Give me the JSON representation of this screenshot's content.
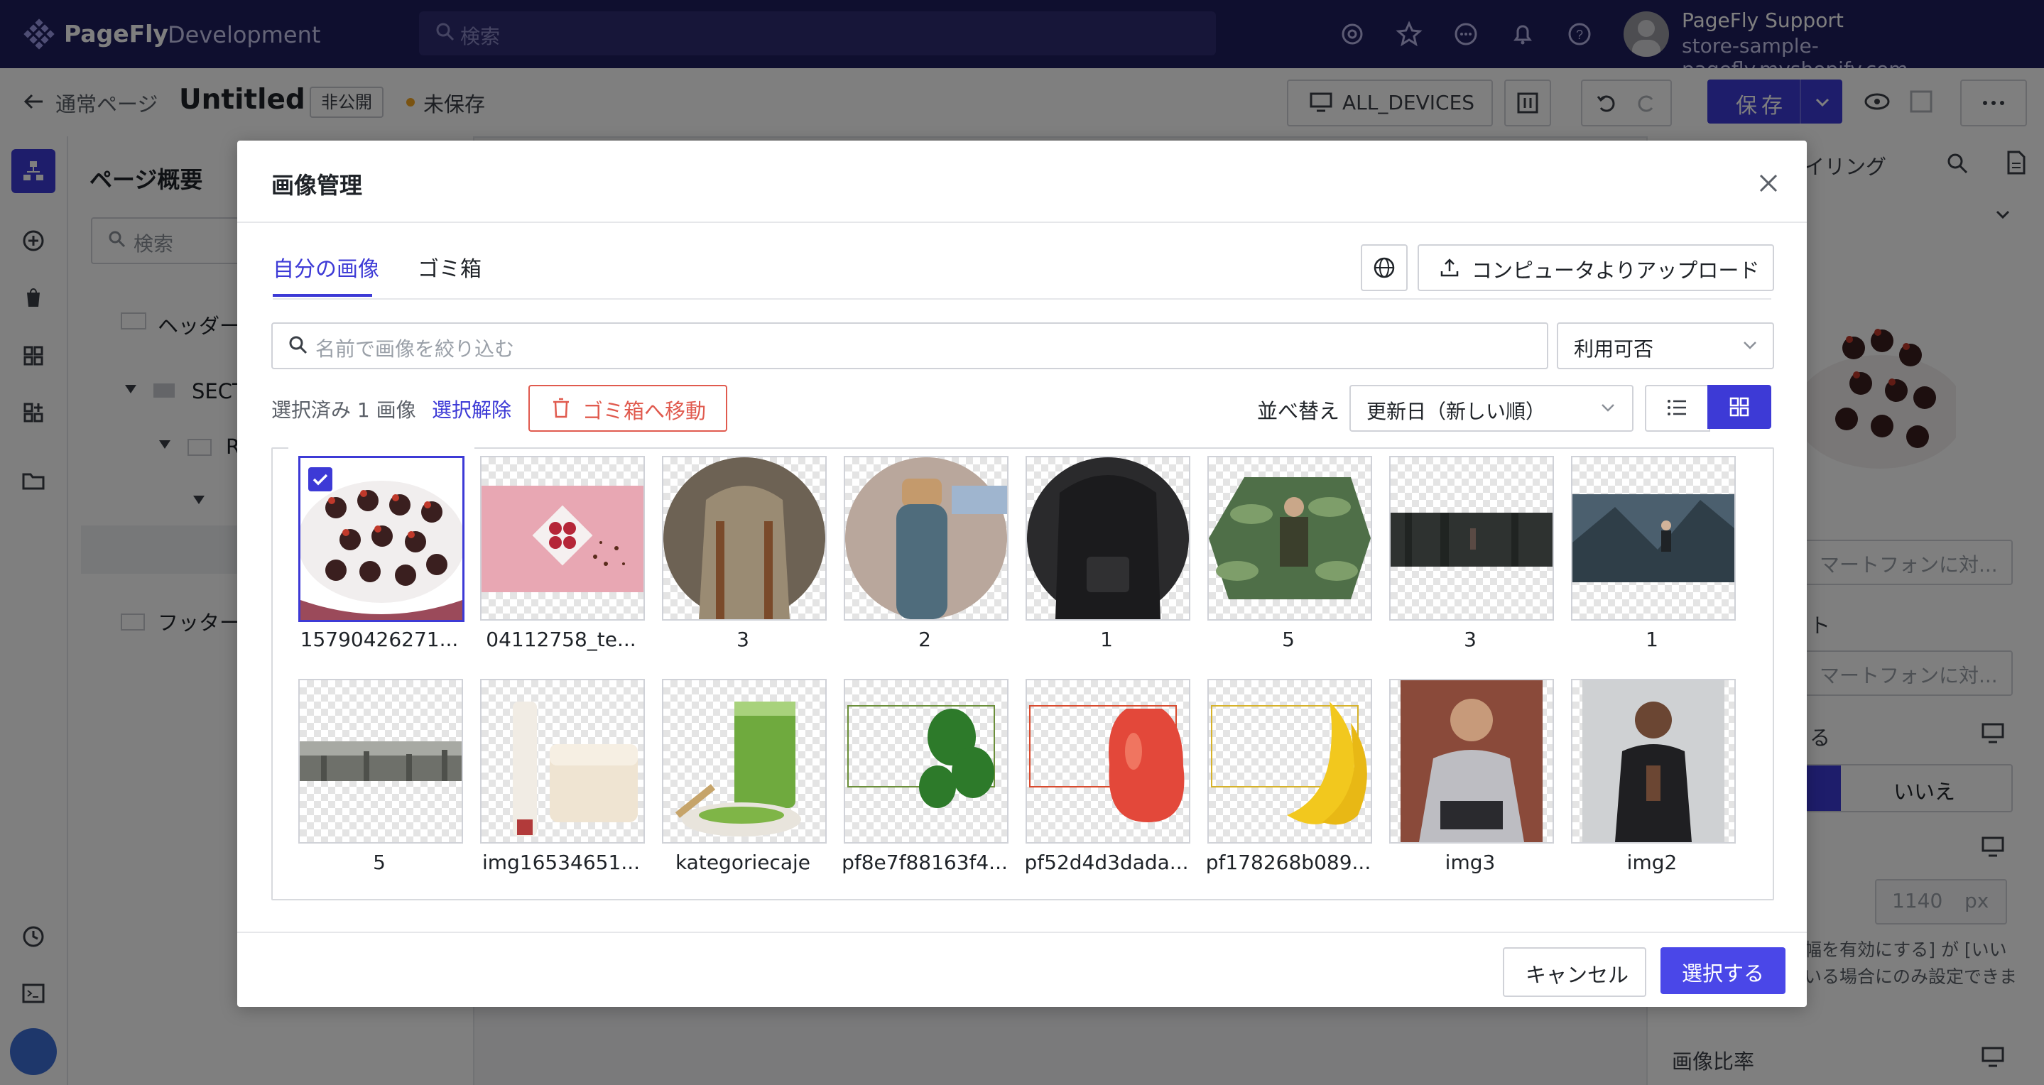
{
  "app": {
    "brand_name": "PageFly",
    "brand_env": "Development",
    "search_placeholder": "検索",
    "user_name": "PageFly Support",
    "user_store": "store-sample-pagefly.myshopify.com"
  },
  "subheader": {
    "breadcrumb": "通常ページ",
    "title": "Untitled",
    "visibility_badge": "非公開",
    "save_status": "未保存",
    "devices_label": "ALL_DEVICES",
    "save_label": "保存"
  },
  "left_panel": {
    "title": "ページ概要",
    "search_placeholder": "検索",
    "tree": [
      "ヘッダー",
      "SECT",
      "R",
      "フッター"
    ]
  },
  "right_panel": {
    "tab_partial": "イリング",
    "input1_placeholder": "マートフォンに対...",
    "label_t": "ト",
    "input2_placeholder": "マートフォンに対...",
    "label_ru": "る",
    "toggle_no": "いいえ",
    "width_value": "1140",
    "width_unit": "px",
    "note_line1": "幅を有効にする] が [いい",
    "note_line2": "いる場合にのみ設定できま",
    "aspect_ratio": "画像比率"
  },
  "modal": {
    "title": "画像管理",
    "tabs": [
      {
        "label": "自分の画像",
        "active": true
      },
      {
        "label": "ゴミ箱",
        "active": false
      }
    ],
    "upload_label": "コンピュータよりアップロード",
    "filter_placeholder": "名前で画像を絞り込む",
    "availability_select": "利用可否",
    "selected_count": "選択済み 1 画像",
    "deselect_label": "選択解除",
    "trash_label": "ゴミ箱へ移動",
    "sort_label": "並べ替え",
    "sort_value": "更新日（新しい順）",
    "images": [
      {
        "caption": "15790426271...",
        "selected": true
      },
      {
        "caption": "04112758_te...",
        "selected": false
      },
      {
        "caption": "3",
        "selected": false
      },
      {
        "caption": "2",
        "selected": false
      },
      {
        "caption": "1",
        "selected": false
      },
      {
        "caption": "5",
        "selected": false
      },
      {
        "caption": "3",
        "selected": false
      },
      {
        "caption": "1",
        "selected": false
      },
      {
        "caption": "5",
        "selected": false
      },
      {
        "caption": "img16534651...",
        "selected": false
      },
      {
        "caption": "kategoriecaje",
        "selected": false
      },
      {
        "caption": "pf8e7f88163f4...",
        "selected": false
      },
      {
        "caption": "pf52d4d3dada...",
        "selected": false
      },
      {
        "caption": "pf178268b089...",
        "selected": false
      },
      {
        "caption": "img3",
        "selected": false
      },
      {
        "caption": "img2",
        "selected": false
      }
    ],
    "cancel_label": "キャンセル",
    "select_label": "選択する"
  },
  "colors": {
    "accent": "#3d3ad6",
    "topbar": "#1f1e5e",
    "danger": "#e05a4e"
  }
}
